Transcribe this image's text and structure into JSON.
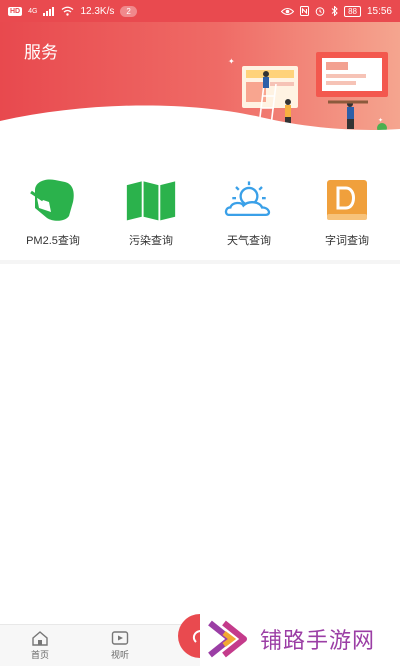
{
  "status_bar": {
    "hd": "HD",
    "network": "4G",
    "speed": "12.3K/s",
    "notification_count": "2",
    "battery": "88",
    "time": "15:56"
  },
  "header": {
    "title": "服务"
  },
  "services": [
    {
      "label": "PM2.5查询",
      "icon": "mask-icon",
      "color": "#2bb24c"
    },
    {
      "label": "污染查询",
      "icon": "map-icon",
      "color": "#2bb24c"
    },
    {
      "label": "天气查询",
      "icon": "weather-icon",
      "color": "#3aa0e8"
    },
    {
      "label": "字词查询",
      "icon": "dictionary-icon",
      "color": "#f0a03c"
    }
  ],
  "bottom_nav": {
    "home_label": "首页",
    "media_label": "视听"
  },
  "watermark": {
    "text": "铺路手游网"
  },
  "colors": {
    "accent": "#e94a4f",
    "green": "#2bb24c",
    "blue": "#3aa0e8",
    "orange": "#f0a03c"
  }
}
